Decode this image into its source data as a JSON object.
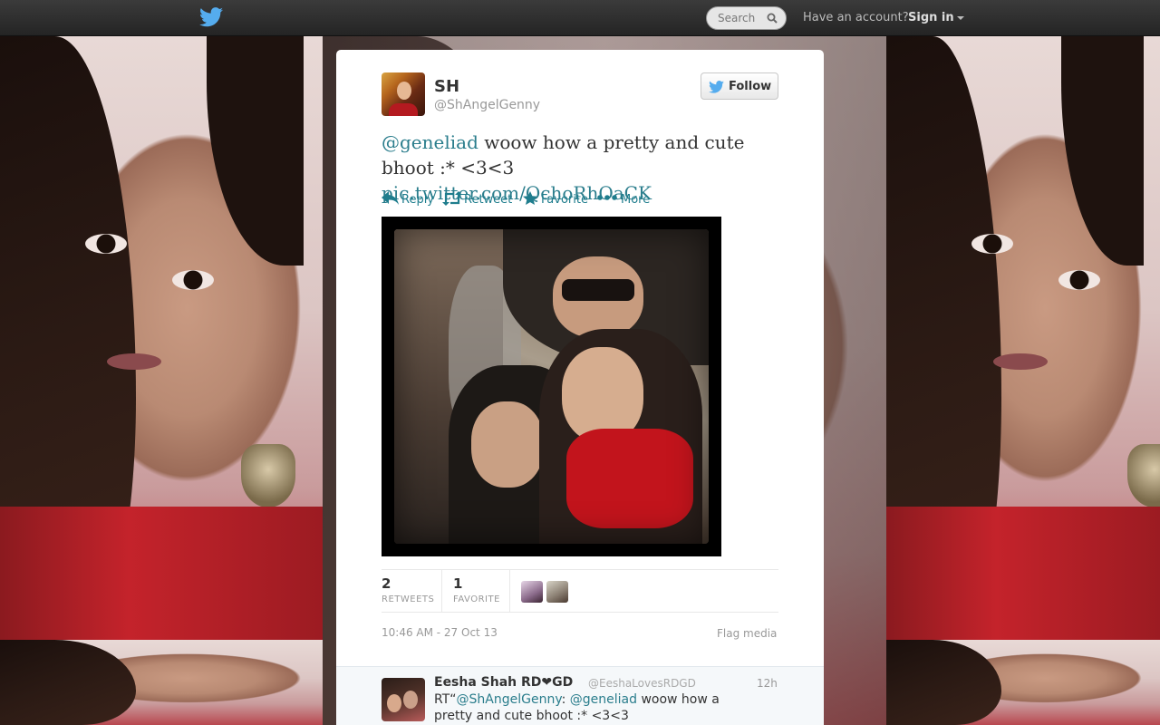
{
  "topbar": {
    "search_placeholder": "Search",
    "account_prompt": "Have an account?",
    "signin_label": "Sign in"
  },
  "tweet": {
    "author_name": "SH",
    "author_handle": "@ShAngelGenny",
    "follow_label": "Follow",
    "text_mention": "@geneliad",
    "text_body": " woow how a pretty and cute bhoot :* <3<3 ",
    "text_link": "pic.twitter.com/QchoRhOaCK",
    "actions": {
      "reply": "Reply",
      "retweet": "Retweet",
      "favorite": "Favorite",
      "more": "More"
    },
    "stats": {
      "retweets_count": "2",
      "retweets_label": "RETWEETS",
      "favorites_count": "1",
      "favorites_label": "FAVORITE"
    },
    "timestamp": "10:46 AM - 27 Oct 13",
    "flag_label": "Flag media"
  },
  "reply": {
    "name": "Eesha Shah RD❤GD",
    "handle": "@EeshaLovesRDGD",
    "time": "12h",
    "text_prefix": "RT“",
    "mention1": "@ShAngelGenny",
    "text_mid": ": ",
    "mention2": "@geneliad",
    "text_rest": " woow how a pretty and cute bhoot :* <3<3"
  },
  "icons": {
    "brand_bird": "twitter-bird-icon",
    "search": "search-icon",
    "reply": "reply-arrow-icon",
    "retweet": "retweet-icon",
    "favorite": "star-icon",
    "more": "ellipsis-icon"
  },
  "colors": {
    "link": "#2a7d8c",
    "action": "#1f7d8d",
    "brand_bird": "#55acee",
    "topbar": "#2e2e2e"
  }
}
